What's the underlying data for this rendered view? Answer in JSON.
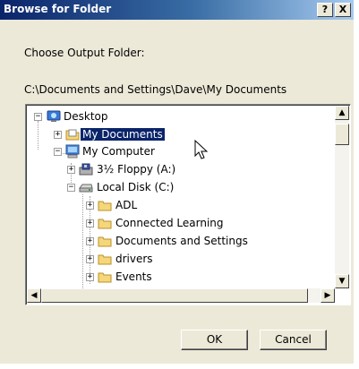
{
  "window": {
    "title": "Browse for Folder",
    "help_label": "?",
    "close_label": "X"
  },
  "instruction": "Choose Output Folder:",
  "current_path": "C:\\Documents and Settings\\Dave\\My Documents",
  "tree": {
    "items": [
      {
        "label": "Desktop",
        "expander": "−",
        "icon": "desktop-icon"
      },
      {
        "label": "My Documents",
        "expander": "+",
        "icon": "my-documents-folder-icon",
        "selected": true
      },
      {
        "label": "My Computer",
        "expander": "−",
        "icon": "my-computer-icon"
      },
      {
        "label": "3½ Floppy (A:)",
        "expander": "+",
        "icon": "floppy-drive-icon"
      },
      {
        "label": "Local Disk (C:)",
        "expander": "−",
        "icon": "hard-disk-icon"
      },
      {
        "label": "ADL",
        "expander": "+",
        "icon": "folder-icon"
      },
      {
        "label": "Connected Learning",
        "expander": "+",
        "icon": "folder-icon"
      },
      {
        "label": "Documents and Settings",
        "expander": "+",
        "icon": "folder-icon"
      },
      {
        "label": "drivers",
        "expander": "+",
        "icon": "folder-icon"
      },
      {
        "label": "Events",
        "expander": "+",
        "icon": "folder-icon"
      }
    ]
  },
  "scroll": {
    "up_arrow": "▲",
    "down_arrow": "▼",
    "left_arrow": "◀",
    "right_arrow": "▶"
  },
  "buttons": {
    "ok": "OK",
    "cancel": "Cancel"
  },
  "colors": {
    "title_bar": "#0a246a",
    "selection": "#0a246a",
    "dialog_face": "#ece9d8",
    "folder": "#f5d67a"
  }
}
